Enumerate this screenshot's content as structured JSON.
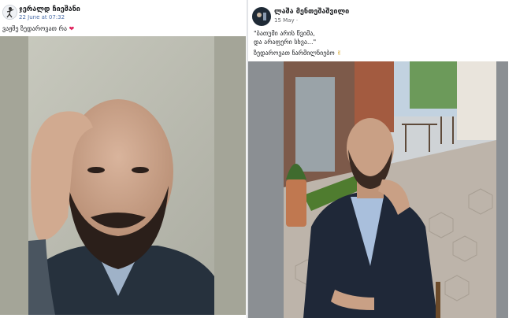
{
  "posts": [
    {
      "author": "ჯერალდ ჩიეშანი",
      "time": "22 June at 07:32",
      "text": "ვაჟშე ზედაროვათ რა",
      "reaction": "❤",
      "colors": {
        "heart": "#e0245e"
      }
    },
    {
      "author": "ლაშა მენთეშაშვილი",
      "time": "15 May",
      "time_suffix": "·",
      "quote_line1": "\"ბათუმი არის წვიმა,",
      "quote_line2": "და არაფერი სხვა...\"",
      "text2": "ზედაროვათ ნარმილნიებო",
      "reaction": "✌"
    }
  ]
}
